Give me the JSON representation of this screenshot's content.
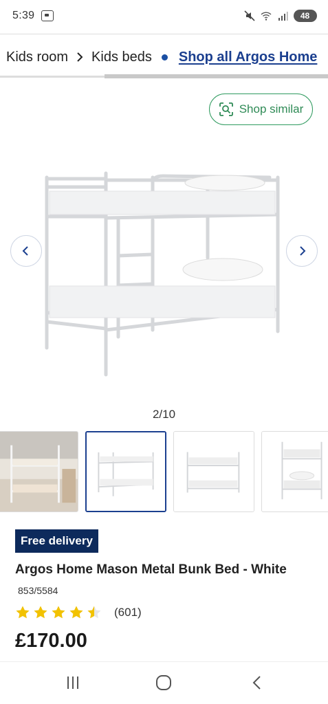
{
  "status_bar": {
    "time": "5:39",
    "battery": "48",
    "icons": [
      "screen-record-icon",
      "mute-icon",
      "wifi-icon",
      "signal-icon",
      "battery-icon"
    ]
  },
  "breadcrumb": {
    "items": [
      "Kids room",
      "Kids beds"
    ],
    "link": "Shop all Argos Home"
  },
  "shop_similar": {
    "label": "Shop similar",
    "icon": "lens-icon"
  },
  "gallery": {
    "counter": "2/10",
    "current": 2,
    "total": 10,
    "prev_icon": "chevron-left-icon",
    "next_icon": "chevron-right-icon"
  },
  "product": {
    "badge": "Free delivery",
    "title": "Argos Home Mason Metal Bunk Bed - White",
    "sku": "853/5584",
    "rating": 4.5,
    "review_count": "(601)",
    "price": "£170.00"
  },
  "colors": {
    "brand_blue": "#1b3f8f",
    "badge_navy": "#0d2a5c",
    "green": "#2e9a5e",
    "star": "#f2c200"
  }
}
